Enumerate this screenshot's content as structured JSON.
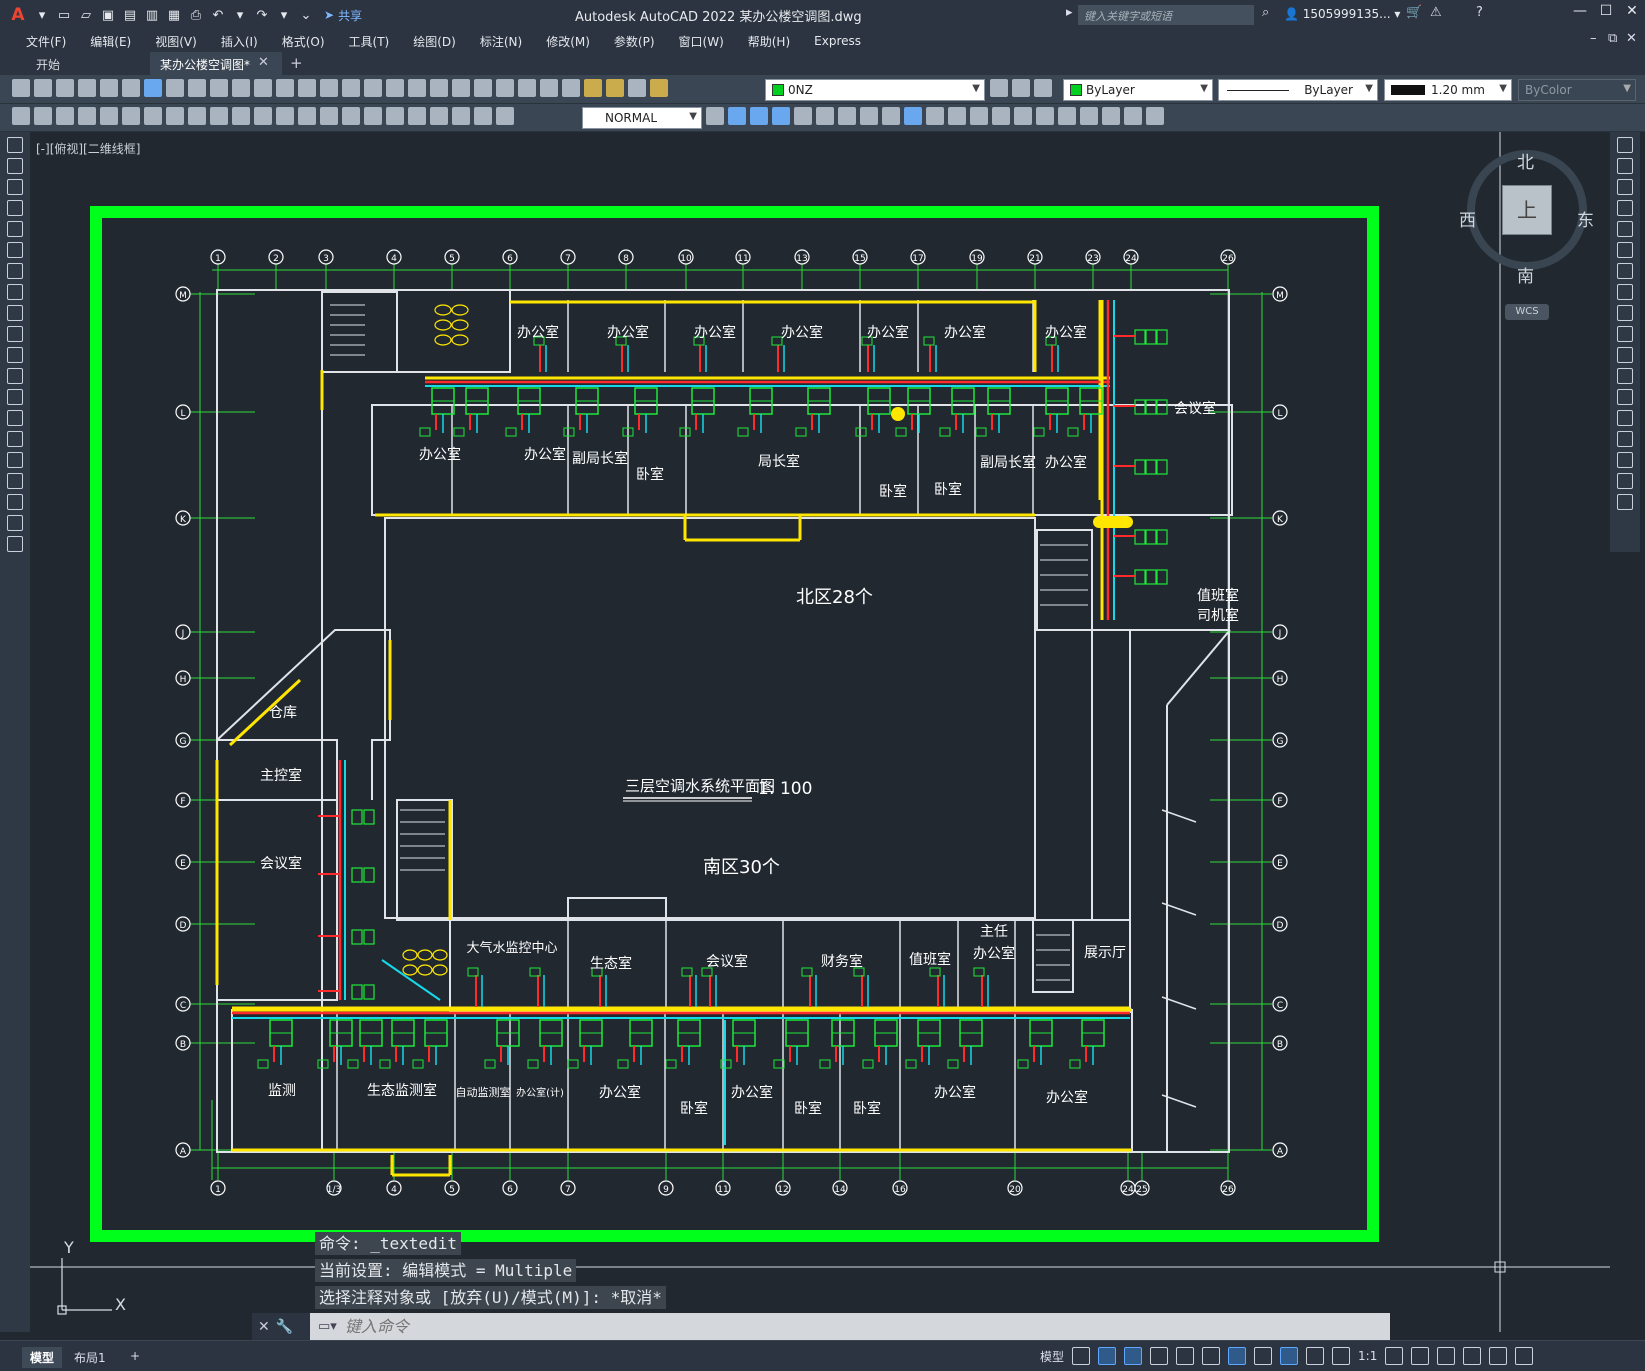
{
  "app": {
    "title": "Autodesk AutoCAD 2022    某办公楼空调图.dwg",
    "share_label": "共享",
    "search_placeholder": "键入关键字或短语",
    "user": "1505999135..."
  },
  "menu": [
    "文件(F)",
    "编辑(E)",
    "视图(V)",
    "插入(I)",
    "格式(O)",
    "工具(T)",
    "绘图(D)",
    "标注(N)",
    "修改(M)",
    "参数(P)",
    "窗口(W)",
    "帮助(H)",
    "Express"
  ],
  "tabs": [
    {
      "label": "开始"
    },
    {
      "label": "某办公楼空调图*"
    }
  ],
  "properties": {
    "layer": "0NZ",
    "visual_style": "NORMAL",
    "color": "ByLayer",
    "linetype": "ByLayer",
    "lineweight": "1.20 mm",
    "plotstyle": "ByColor"
  },
  "viewport_label": "[-][俯视][二维线框]",
  "viewcube": {
    "north": "北",
    "south": "南",
    "east": "东",
    "west": "西",
    "face": "上",
    "wcs": "WCS"
  },
  "drawing": {
    "plan_title": "三层空调水系统平面图",
    "scale": "1: 100",
    "north_count": "北区28个",
    "south_count": "南区30个",
    "grid_top": [
      "1",
      "2",
      "3",
      "4",
      "5",
      "6",
      "7",
      "8",
      "10",
      "11",
      "13",
      "15",
      "17",
      "19",
      "21",
      "23",
      "24",
      "26"
    ],
    "grid_bottom": [
      "1",
      "1/3",
      "4",
      "5",
      "6",
      "7",
      "9",
      "11",
      "12",
      "14",
      "16",
      "20",
      "24",
      "25",
      "26"
    ],
    "grid_left": [
      "M",
      "L",
      "K",
      "J",
      "H",
      "G",
      "F",
      "E",
      "D",
      "C",
      "B",
      "A"
    ],
    "rooms": {
      "north_top": [
        "办公室",
        "办公室",
        "办公室",
        "办公室",
        "办公室",
        "办公室",
        "办公室"
      ],
      "north_mid": [
        "办公室",
        "办公室",
        "副局长室",
        "卧室",
        "局长室",
        "卧室",
        "卧室",
        "副局长室",
        "办公室"
      ],
      "east": [
        "会议室",
        "值班室",
        "司机室"
      ],
      "west": [
        "仓库",
        "主控室",
        "会议室"
      ],
      "south_top": [
        "大气水监控中心",
        "生态室",
        "会议室",
        "财务室",
        "值班室",
        "主任",
        "办公室",
        "展示厅"
      ],
      "south_bottom": [
        "监测",
        "生态监测室",
        "自动监测室",
        "办公室(计)",
        "办公室",
        "卧室",
        "办公室",
        "卧室",
        "卧室",
        "办公室",
        "办公室"
      ]
    }
  },
  "command": {
    "history": [
      "命令: _textedit",
      "当前设置: 编辑模式 = Multiple",
      "选择注释对象或 [放弃(U)/模式(M)]: *取消*"
    ],
    "placeholder": "键入命令"
  },
  "status": {
    "layout_tabs": [
      "模型",
      "布局1"
    ],
    "model_label": "模型",
    "scale": "1:1"
  },
  "colors": {
    "frame": "#00ff1a",
    "wall": "#e0e4e8",
    "pipe_red": "#ff2a2a",
    "pipe_yellow": "#ffe600",
    "pipe_cyan": "#16d8e8",
    "unit_green": "#1ee83a",
    "bg": "#212830"
  }
}
